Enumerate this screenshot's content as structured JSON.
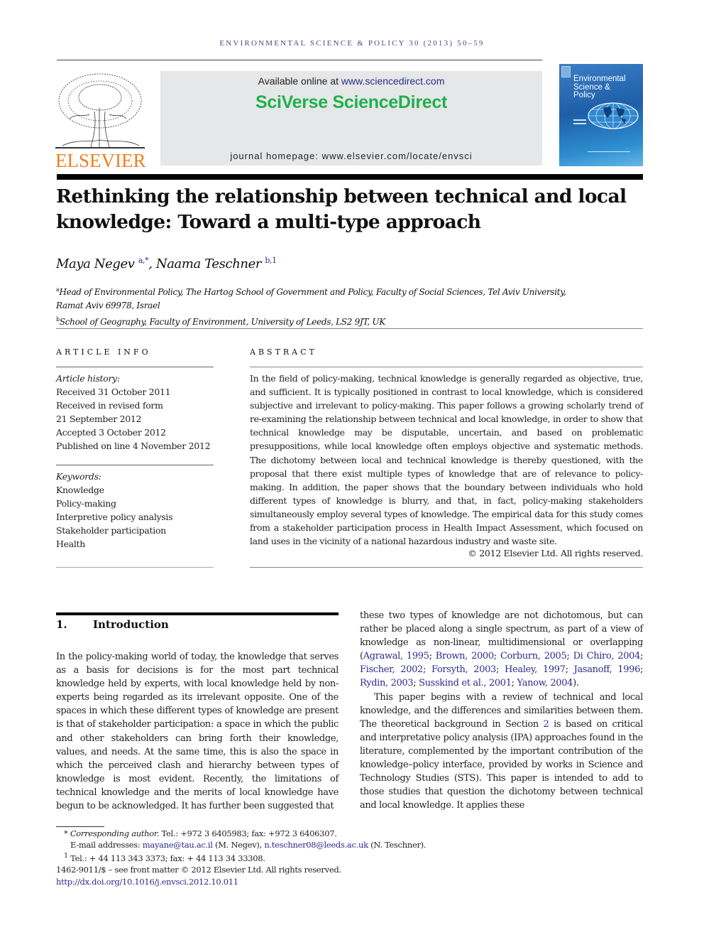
{
  "running_head": "ENVIRONMENTAL SCIENCE & POLICY 30 (2013) 50–59",
  "masthead": {
    "publisher_logo_text": "ELSEVIER",
    "available_online_prefix": "Available online at ",
    "available_online_link": "www.sciencedirect.com",
    "platform_brand": "SciVerse ScienceDirect",
    "journal_homepage": "journal homepage: www.elsevier.com/locate/envsci",
    "cover_title": [
      "Environmental",
      "Science &",
      "Policy"
    ],
    "brand_color": "#1fb14b",
    "publisher_color": "#f07f1e"
  },
  "article": {
    "title_line1": "Rethinking the relationship between technical and local",
    "title_line2": "knowledge: Toward a multi-type approach",
    "authors": [
      {
        "name": "Maya Negev",
        "marks": "a,*"
      },
      {
        "name": "Naama Teschner",
        "marks": "b,1"
      }
    ],
    "author_separator": ", ",
    "affiliations": [
      {
        "mark": "a",
        "line1": "Head of Environmental Policy, The Hartog School of Government and Policy, Faculty of Social Sciences, Tel Aviv University,",
        "line2": "Ramat Aviv 69978, Israel"
      },
      {
        "mark": "b",
        "line1": "School of Geography, Faculty of Environment, University of Leeds, LS2 9JT, UK"
      }
    ]
  },
  "article_info": {
    "heading": "ARTICLE INFO",
    "history_label": "Article history:",
    "history": [
      "Received 31 October 2011",
      "Received in revised form",
      "21 September 2012",
      "Accepted 3 October 2012",
      "Published on line 4 November 2012"
    ],
    "keywords_label": "Keywords:",
    "keywords": [
      "Knowledge",
      "Policy-making",
      "Interpretive policy analysis",
      "Stakeholder participation",
      "Health"
    ]
  },
  "abstract": {
    "heading": "ABSTRACT",
    "text": "In the field of policy-making, technical knowledge is generally regarded as objective, true, and sufficient. It is typically positioned in contrast to local knowledge, which is considered subjective and irrelevant to policy-making. This paper follows a growing scholarly trend of re-examining the relationship between technical and local knowledge, in order to show that technical knowledge may be disputable, uncertain, and based on problematic presuppositions, while local knowledge often employs objective and systematic methods. The dichotomy between local and technical knowledge is thereby questioned, with the proposal that there exist multiple types of knowledge that are of relevance to policy-making. In addition, the paper shows that the boundary between individuals who hold different types of knowledge is blurry, and that, in fact, policy-making stakeholders simultaneously employ several types of knowledge. The empirical data for this study comes from a stakeholder participation process in Health Impact Assessment, which focused on land uses in the vicinity of a national hazardous industry and waste site.",
    "copyright": "© 2012 Elsevier Ltd. All rights reserved."
  },
  "introduction": {
    "number": "1.",
    "heading": "Introduction",
    "left_column": "In the policy-making world of today, the knowledge that serves as a basis for decisions is for the most part technical knowledge held by experts, with local knowledge held by non-experts being regarded as its irrelevant opposite. One of the spaces in which these different types of knowledge are present is that of stakeholder participation: a space in which the public and other stakeholders can bring forth their knowledge, values, and needs. At the same time, this is also the space in which the perceived clash and hierarchy between types of knowledge is most evident. Recently, the limitations of technical knowledge and the merits of local knowledge have begun to be acknowledged. It has further been suggested that",
    "right_p1_text": "these two types of knowledge are not dichotomous, but can rather be placed along a single spectrum, as part of a view of knowledge as non-linear, multidimensional or overlapping (",
    "citations": [
      "Agrawal, 1995",
      "Brown, 2000",
      "Corburn, 2005",
      "Di Chiro, 2004",
      "Fischer, 2002",
      "Forsyth, 2003",
      "Healey, 1997",
      "Jasanoff, 1996",
      "Rydin, 2003",
      "Susskind et al., 2001",
      "Yanow, 2004"
    ],
    "citation_separator": "; ",
    "right_p1_close": ").",
    "right_p2_before": "This paper begins with a review of technical and local knowledge, and the differences and similarities between them. The theoretical background in Section ",
    "right_p2_section_link": "2",
    "right_p2_after": " is based on critical and interpretative policy analysis (IPA) approaches found in the literature, complemented by the important contribution of the knowledge–policy interface, provided by works in Science and Technology Studies (STS). This paper is intended to add to those studies that question the dichotomy between technical and local knowledge. It applies these"
  },
  "footnotes": {
    "corresponding_mark": "*",
    "corresponding_label": "Corresponding author.",
    "corresponding_contact": " Tel.: +972 3 6405983; fax: +972 3 6406307.",
    "email_label": "E-mail addresses: ",
    "email1": "mayane@tau.ac.il",
    "email1_owner": " (M. Negev), ",
    "email2": "n.teschner08@leeds.ac.uk",
    "email2_owner": " (N. Teschner).",
    "note1_mark": "1",
    "note1_text": " Tel.: + 44 113 343 3373; fax: + 44 113 34 33308.",
    "front_matter": "1462-9011/$ – see front matter © 2012 Elsevier Ltd. All rights reserved.",
    "doi": "http://dx.doi.org/10.1016/j.envsci.2012.10.011"
  }
}
